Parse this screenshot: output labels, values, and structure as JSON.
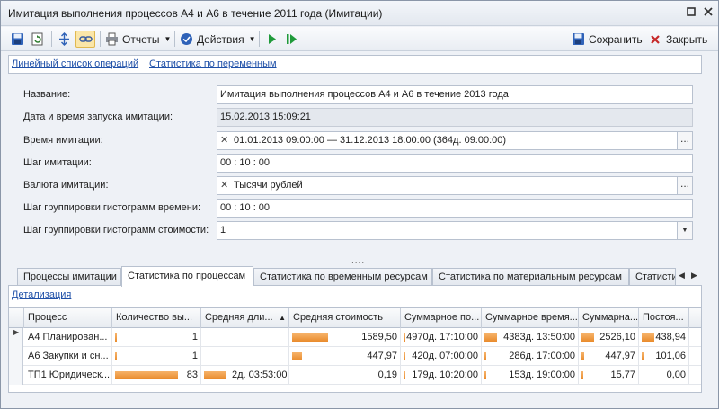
{
  "window": {
    "title": "Имитация выполнения процессов А4 и А6 в течение 2011 года (Имитации)",
    "controls": [
      "pin-icon",
      "maximize-icon",
      "close-icon"
    ]
  },
  "toolbar": {
    "reports_label": "Отчеты",
    "actions_label": "Действия",
    "save_label": "Сохранить",
    "close_label": "Закрыть"
  },
  "links": {
    "operations_list": "Линейный список операций",
    "variable_stats": "Статистика по переменным"
  },
  "form": {
    "name_label": "Название:",
    "name_value": "Имитация выполнения процессов А4 и А6 в течение 2013 года",
    "start_label": "Дата и время запуска имитации:",
    "start_value": "15.02.2013 15:09:21",
    "period_label": "Время имитации:",
    "period_value": "01.01.2013 09:00:00 — 31.12.2013 18:00:00 (364д. 09:00:00)",
    "step_label": "Шаг имитации:",
    "step_value": "00 : 10 : 00",
    "currency_label": "Валюта имитации:",
    "currency_value": "Тысячи рублей",
    "time_hist_label": "Шаг группировки гистограмм времени:",
    "time_hist_value": "00 : 10 : 00",
    "cost_hist_label": "Шаг группировки гистограмм стоимости:",
    "cost_hist_value": "1"
  },
  "tabs": [
    {
      "label": "Процессы имитации",
      "active": false
    },
    {
      "label": "Статистика по процессам",
      "active": true
    },
    {
      "label": "Статистика по временным ресурсам",
      "active": false
    },
    {
      "label": "Статистика по материальным ресурсам",
      "active": false
    },
    {
      "label": "Статисти",
      "active": false
    }
  ],
  "detail_link": "Детализация",
  "grid": {
    "columns": [
      "Процесс",
      "Количество вы...",
      "Средняя дли...",
      "Средняя стоимость",
      "Суммарное по...",
      "Суммарное время...",
      "Суммарна...",
      "Постоя..."
    ],
    "sorted_column": "Средняя дли...",
    "rows": [
      {
        "current": true,
        "process": "А4 Планирован...",
        "count": "1",
        "count_level": 0.02,
        "avg_duration": "",
        "avg_duration_level": 0,
        "avg_cost": "1589,50",
        "avg_cost_level": 1.0,
        "total_po": "4970д. 17:10:00",
        "total_po_level": 0.02,
        "total_time": "4383д. 13:50:00",
        "total_time_level": 1.0,
        "total_cost": "2526,10",
        "total_cost_level": 1.0,
        "fixed": "438,94",
        "fixed_level": 1.0
      },
      {
        "current": false,
        "process": "А6 Закупки и сн...",
        "count": "1",
        "count_level": 0.02,
        "avg_duration": "",
        "avg_duration_level": 0,
        "avg_cost": "447,97",
        "avg_cost_level": 0.28,
        "total_po": "420д. 07:00:00",
        "total_po_level": 0.01,
        "total_time": "286д. 17:00:00",
        "total_time_level": 0.07,
        "total_cost": "447,97",
        "total_cost_level": 0.18,
        "fixed": "101,06",
        "fixed_level": 0.23
      },
      {
        "current": false,
        "process": "ТП1 Юридическ...",
        "count": "83",
        "count_level": 1.0,
        "avg_duration": "2д. 03:53:00",
        "avg_duration_level": 1.0,
        "avg_cost": "0,19",
        "avg_cost_level": 0,
        "total_po": "179д. 10:20:00",
        "total_po_level": 0.01,
        "total_time": "153д. 19:00:00",
        "total_time_level": 0.04,
        "total_cost": "15,77",
        "total_cost_level": 0.01,
        "fixed": "0,00",
        "fixed_level": 0
      }
    ]
  }
}
